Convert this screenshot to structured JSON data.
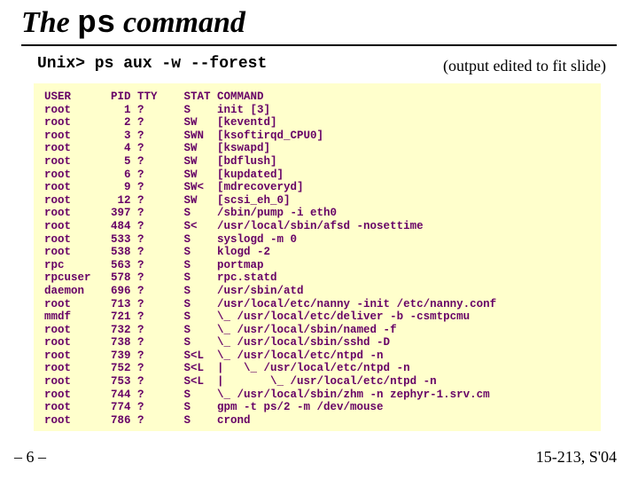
{
  "title_prefix": "The ",
  "title_cmd": "ps",
  "title_suffix": " command",
  "cmdline": "Unix> ps aux -w --forest",
  "edited_note": "(output edited to fit slide)",
  "page_num": "– 6 –",
  "course": "15-213, S'04",
  "chart_data": {
    "type": "table",
    "title": "ps aux -w --forest output",
    "columns": [
      "USER",
      "PID",
      "TTY",
      "STAT",
      "COMMAND"
    ],
    "rows": [
      {
        "USER": "root",
        "PID": 1,
        "TTY": "?",
        "STAT": "S",
        "COMMAND": "init [3]"
      },
      {
        "USER": "root",
        "PID": 2,
        "TTY": "?",
        "STAT": "SW",
        "COMMAND": "[keventd]"
      },
      {
        "USER": "root",
        "PID": 3,
        "TTY": "?",
        "STAT": "SWN",
        "COMMAND": "[ksoftirqd_CPU0]"
      },
      {
        "USER": "root",
        "PID": 4,
        "TTY": "?",
        "STAT": "SW",
        "COMMAND": "[kswapd]"
      },
      {
        "USER": "root",
        "PID": 5,
        "TTY": "?",
        "STAT": "SW",
        "COMMAND": "[bdflush]"
      },
      {
        "USER": "root",
        "PID": 6,
        "TTY": "?",
        "STAT": "SW",
        "COMMAND": "[kupdated]"
      },
      {
        "USER": "root",
        "PID": 9,
        "TTY": "?",
        "STAT": "SW<",
        "COMMAND": "[mdrecoveryd]"
      },
      {
        "USER": "root",
        "PID": 12,
        "TTY": "?",
        "STAT": "SW",
        "COMMAND": "[scsi_eh_0]"
      },
      {
        "USER": "root",
        "PID": 397,
        "TTY": "?",
        "STAT": "S",
        "COMMAND": "/sbin/pump -i eth0"
      },
      {
        "USER": "root",
        "PID": 484,
        "TTY": "?",
        "STAT": "S<",
        "COMMAND": "/usr/local/sbin/afsd -nosettime"
      },
      {
        "USER": "root",
        "PID": 533,
        "TTY": "?",
        "STAT": "S",
        "COMMAND": "syslogd -m 0"
      },
      {
        "USER": "root",
        "PID": 538,
        "TTY": "?",
        "STAT": "S",
        "COMMAND": "klogd -2"
      },
      {
        "USER": "rpc",
        "PID": 563,
        "TTY": "?",
        "STAT": "S",
        "COMMAND": "portmap"
      },
      {
        "USER": "rpcuser",
        "PID": 578,
        "TTY": "?",
        "STAT": "S",
        "COMMAND": "rpc.statd"
      },
      {
        "USER": "daemon",
        "PID": 696,
        "TTY": "?",
        "STAT": "S",
        "COMMAND": "/usr/sbin/atd"
      },
      {
        "USER": "root",
        "PID": 713,
        "TTY": "?",
        "STAT": "S",
        "COMMAND": "/usr/local/etc/nanny -init /etc/nanny.conf"
      },
      {
        "USER": "mmdf",
        "PID": 721,
        "TTY": "?",
        "STAT": "S",
        "COMMAND": "\\_ /usr/local/etc/deliver -b -csmtpcmu"
      },
      {
        "USER": "root",
        "PID": 732,
        "TTY": "?",
        "STAT": "S",
        "COMMAND": "\\_ /usr/local/sbin/named -f"
      },
      {
        "USER": "root",
        "PID": 738,
        "TTY": "?",
        "STAT": "S",
        "COMMAND": "\\_ /usr/local/sbin/sshd -D"
      },
      {
        "USER": "root",
        "PID": 739,
        "TTY": "?",
        "STAT": "S<L",
        "COMMAND": "\\_ /usr/local/etc/ntpd -n"
      },
      {
        "USER": "root",
        "PID": 752,
        "TTY": "?",
        "STAT": "S<L",
        "COMMAND": "|   \\_ /usr/local/etc/ntpd -n"
      },
      {
        "USER": "root",
        "PID": 753,
        "TTY": "?",
        "STAT": "S<L",
        "COMMAND": "|       \\_ /usr/local/etc/ntpd -n"
      },
      {
        "USER": "root",
        "PID": 744,
        "TTY": "?",
        "STAT": "S",
        "COMMAND": "\\_ /usr/local/sbin/zhm -n zephyr-1.srv.cm"
      },
      {
        "USER": "root",
        "PID": 774,
        "TTY": "?",
        "STAT": "S",
        "COMMAND": "gpm -t ps/2 -m /dev/mouse"
      },
      {
        "USER": "root",
        "PID": 786,
        "TTY": "?",
        "STAT": "S",
        "COMMAND": "crond"
      }
    ]
  }
}
